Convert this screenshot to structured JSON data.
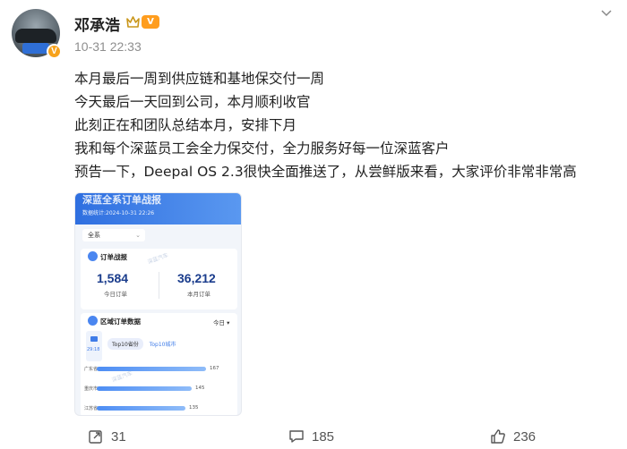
{
  "post": {
    "username": "邓承浩",
    "vip_badge": "V",
    "verified_badge": "V",
    "timestamp": "10-31 22:33",
    "lines": [
      "本月最后一周到供应链和基地保交付一周",
      "今天最后一天回到公司，本月顺利收官",
      "此刻正在和团队总结本月，安排下月",
      "我和每个深蓝员工会全力保交付，全力服务好每一位深蓝客户",
      "预告一下，Deepal OS 2.3很快全面推送了，从尝鲜版来看，大家评价非常非常高"
    ]
  },
  "image": {
    "header_title": "深蓝全系订单战报",
    "header_sub": "数据统计:2024-10-31 22:26",
    "filter_value": "全系",
    "filter_caret": "⌄",
    "orders_card": {
      "title": "订单战报",
      "today_value": "1,584",
      "today_label": "今日订单",
      "month_value": "36,212",
      "month_label": "本月订单"
    },
    "region_card": {
      "title": "区域订单数据",
      "period": "今日 ▾",
      "cam_time": "29:18",
      "tabs": [
        "Top10省份",
        "Top10城市"
      ],
      "rows": [
        {
          "label": "广东省",
          "value": 167
        },
        {
          "label": "重庆市",
          "value": 145
        },
        {
          "label": "江苏省",
          "value": 135
        }
      ]
    }
  },
  "actions": {
    "repost_count": "31",
    "comment_count": "185",
    "like_count": "236"
  },
  "colors": {
    "accent": "#2f6fe0",
    "vip": "#ff9d1e",
    "verified": "#f7a21b",
    "meta": "#8e8e8e"
  },
  "icons": [
    "more-icon",
    "crown-icon",
    "repost-icon",
    "comment-icon",
    "like-icon"
  ]
}
